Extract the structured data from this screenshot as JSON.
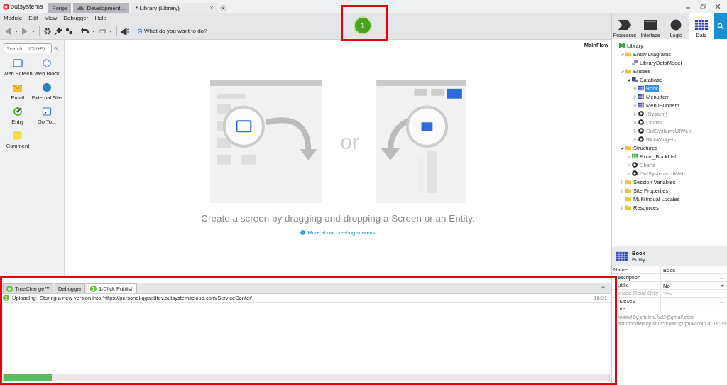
{
  "app": {
    "brand": "outsystems"
  },
  "window_tabs": [
    {
      "label": "Forge",
      "kind": "plain",
      "selected": false
    },
    {
      "label": "Development...",
      "kind": "cloud",
      "selected": false
    },
    {
      "label": "* Library (Library)",
      "kind": "plain",
      "selected": true
    }
  ],
  "menu": [
    "Module",
    "Edit",
    "View",
    "Debugger",
    "Help"
  ],
  "toolbar": {
    "search_placeholder": "What do you want to do?",
    "publish_count": "1"
  },
  "palette": {
    "search_placeholder": "Search... (Ctrl+E)",
    "items": [
      {
        "label": "Web Screen",
        "kind": "screen"
      },
      {
        "label": "Web Block",
        "kind": "block"
      },
      {
        "label": "Email",
        "kind": "email"
      },
      {
        "label": "External Site",
        "kind": "globe"
      },
      {
        "label": "Entry",
        "kind": "entry"
      },
      {
        "label": "Go To...",
        "kind": "goto"
      },
      {
        "label": "Comment",
        "kind": "note"
      }
    ]
  },
  "canvas": {
    "flow": "MainFlow",
    "or": "or",
    "message": "Create a screen by dragging and dropping a Screen or an Entity.",
    "link": "More about creating screens"
  },
  "output": {
    "tabs": [
      {
        "label": "TrueChange™",
        "kind": "check",
        "selected": false
      },
      {
        "label": "Debugger",
        "kind": "plain",
        "selected": false
      },
      {
        "label": "1-Click Publish",
        "kind": "count",
        "selected": true
      }
    ],
    "tab_badge": "1",
    "messages": [
      {
        "badge": "1",
        "status": "Uploading",
        "text": "Storing a new version into 'https://personal-qgap8tev.outsystemscloud.com/ServiceCenter'.",
        "time": "18:31"
      }
    ],
    "progress": {
      "level": 0.08
    }
  },
  "layers": [
    {
      "label": "Processes",
      "kind": "process",
      "selected": false
    },
    {
      "label": "Interface",
      "kind": "interface",
      "selected": false
    },
    {
      "label": "Logic",
      "kind": "logic",
      "selected": false
    },
    {
      "label": "Data",
      "kind": "data",
      "selected": true
    }
  ],
  "tree": [
    {
      "label": "Library",
      "kind": "module",
      "disabled": false,
      "selected": false,
      "children": [
        {
          "label": "Entity Diagrams",
          "kind": "folder",
          "expanded": true,
          "disabled": false,
          "selected": false,
          "children": [
            {
              "label": "LibraryDataModel",
              "kind": "diagram",
              "disabled": false,
              "selected": false
            }
          ]
        },
        {
          "label": "Entities",
          "kind": "folder",
          "expanded": true,
          "disabled": false,
          "selected": false,
          "children": [
            {
              "label": "Database",
              "kind": "database",
              "expanded": true,
              "disabled": false,
              "selected": false,
              "children": [
                {
                  "label": "Book",
                  "kind": "entity",
                  "expanded": false,
                  "disabled": false,
                  "selected": true
                },
                {
                  "label": "MenuItem",
                  "kind": "entity-ref",
                  "expanded": false,
                  "disabled": false,
                  "selected": false
                },
                {
                  "label": "MenuSubItem",
                  "kind": "entity-ref",
                  "expanded": false,
                  "disabled": false,
                  "selected": false
                },
                {
                  "label": "(System)",
                  "kind": "reference",
                  "expanded": false,
                  "disabled": true,
                  "selected": false
                },
                {
                  "label": "Charts",
                  "kind": "reference",
                  "expanded": false,
                  "disabled": true,
                  "selected": false
                },
                {
                  "label": "OutSystemsUIWeb",
                  "kind": "reference",
                  "expanded": false,
                  "disabled": true,
                  "selected": false
                },
                {
                  "label": "RichWidgets",
                  "kind": "reference",
                  "expanded": false,
                  "disabled": true,
                  "selected": false
                }
              ]
            }
          ]
        },
        {
          "label": "Structures",
          "kind": "folder",
          "expanded": true,
          "disabled": false,
          "selected": false,
          "children": [
            {
              "label": "Excel_BookList",
              "kind": "structure",
              "expanded": false,
              "disabled": false,
              "selected": false
            },
            {
              "label": "Charts",
              "kind": "reference",
              "expanded": false,
              "disabled": true,
              "selected": false
            },
            {
              "label": "OutSystemsUIWeb",
              "kind": "reference",
              "expanded": false,
              "disabled": true,
              "selected": false
            }
          ]
        },
        {
          "label": "Session Variables",
          "kind": "folder",
          "expanded": false,
          "disabled": false,
          "selected": false
        },
        {
          "label": "Site Properties",
          "kind": "folder",
          "expanded": false,
          "disabled": false,
          "selected": false
        },
        {
          "label": "Multilingual Locales",
          "kind": "folder",
          "disabled": false,
          "selected": false
        },
        {
          "label": "Resources",
          "kind": "folder",
          "expanded": false,
          "disabled": false,
          "selected": false
        }
      ]
    }
  ],
  "properties": {
    "title": "Book",
    "subtitle": "Entity",
    "rows": [
      {
        "name": "Name",
        "value": "Book",
        "kind": "text",
        "disabled": false
      },
      {
        "name": "escription",
        "kind": "ellipsis",
        "button": "...",
        "disabled": false
      },
      {
        "name": "ublic",
        "value": "No",
        "kind": "dropdown",
        "disabled": false
      },
      {
        "name": "xpose Read Only",
        "value": "Yes",
        "kind": "text",
        "disabled": true
      },
      {
        "name": "ndexes",
        "kind": "ellipsis",
        "button": "...",
        "disabled": false
      },
      {
        "name": "ore...",
        "kind": "ellipsis",
        "button": "...",
        "disabled": false
      }
    ],
    "footer": [
      "reated by shuichi.kid2@gmail.com",
      "ast modified by shuichi.kid2@gmail.com at 18:29"
    ]
  }
}
